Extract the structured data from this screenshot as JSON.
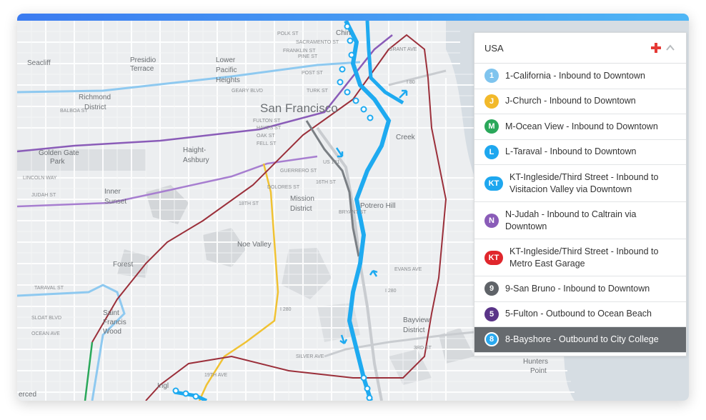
{
  "colors": {
    "topbar_start": "#3b7bf0",
    "topbar_end": "#4fb6f5",
    "route_light_blue": "#8ec9f0",
    "route_purple": "#8a5cb8",
    "route_maroon": "#9b2f3a",
    "route_yellow": "#f0c233",
    "route_bright_blue": "#1eaaf0",
    "route_green": "#2aa85a",
    "add_red": "#e53935",
    "active_row": "#666a6e"
  },
  "map": {
    "city_label": "San Francisco",
    "neighborhoods": [
      "Seacliff",
      "Presidio",
      "Terrace",
      "Lower",
      "Pacific",
      "Heights",
      "Richmond",
      "District",
      "Golden Gate",
      "Park",
      "Haight-",
      "Ashbury",
      "Inner",
      "Sunset",
      "Mission",
      "District",
      "Potrero Hill",
      "Noe Valley",
      "Forest",
      "Saint",
      "Francis",
      "Wood",
      "Bayview",
      "District",
      "Hunters",
      "Point",
      "Creek",
      "Ingl",
      "erced",
      "Chin"
    ],
    "streets": [
      "BALBOA ST",
      "LINCOLN WAY",
      "JUDAH ST",
      "TARAVAL ST",
      "SLOAT BLVD",
      "OCEAN AVE",
      "GEARY BLVD",
      "TURK ST",
      "POST ST",
      "PINE ST",
      "SACRAMENTO ST",
      "FULTON ST",
      "HAYES ST",
      "OAK ST",
      "FELL ST",
      "18TH ST",
      "16TH ST",
      "US 101",
      "I 80",
      "I 280",
      "SILVER AVE",
      "EVANS AVE",
      "3RD ST",
      "BRYANT ST",
      "GUERRERO ST",
      "DOLORES ST",
      "POLK ST",
      "FRANKLIN ST",
      "GRANT AVE",
      "19TH AVE"
    ]
  },
  "panel": {
    "title": "USA",
    "add_icon": "plus-icon",
    "collapse_icon": "chevron-up-icon",
    "routes": [
      {
        "badge": "1",
        "color": "#7fc4ee",
        "name": "1-California - Inbound to Downtown",
        "size": "short"
      },
      {
        "badge": "J",
        "color": "#f2b92a",
        "name": "J-Church - Inbound to Downtown",
        "size": "short"
      },
      {
        "badge": "M",
        "color": "#2aa85a",
        "name": "M-Ocean View - Inbound to Downtown",
        "size": "short"
      },
      {
        "badge": "L",
        "color": "#1ea7ef",
        "name": "L-Taraval - Inbound to Downtown",
        "size": "short"
      },
      {
        "badge": "KT",
        "color": "#1ea7ef",
        "name": "KT-Ingleside/Third Street - Inbound to Visitacion Valley via Downtown",
        "size": "tall"
      },
      {
        "badge": "N",
        "color": "#8a5cb8",
        "name": "N-Judah - Inbound to Caltrain via Downtown",
        "size": "tall"
      },
      {
        "badge": "KT",
        "color": "#e0262c",
        "name": "KT-Ingleside/Third Street - Inbound to Metro East Garage",
        "size": "tall"
      },
      {
        "badge": "9",
        "color": "#5f6368",
        "name": "9-San Bruno - Inbound to Downtown",
        "size": "short"
      },
      {
        "badge": "5",
        "color": "#5a3488",
        "name": "5-Fulton - Outbound to Ocean Beach",
        "size": "short"
      },
      {
        "badge": "8",
        "color": "#2aa9ef",
        "name": "8-Bayshore - Outbound to City College",
        "size": "short",
        "active": true
      }
    ]
  }
}
